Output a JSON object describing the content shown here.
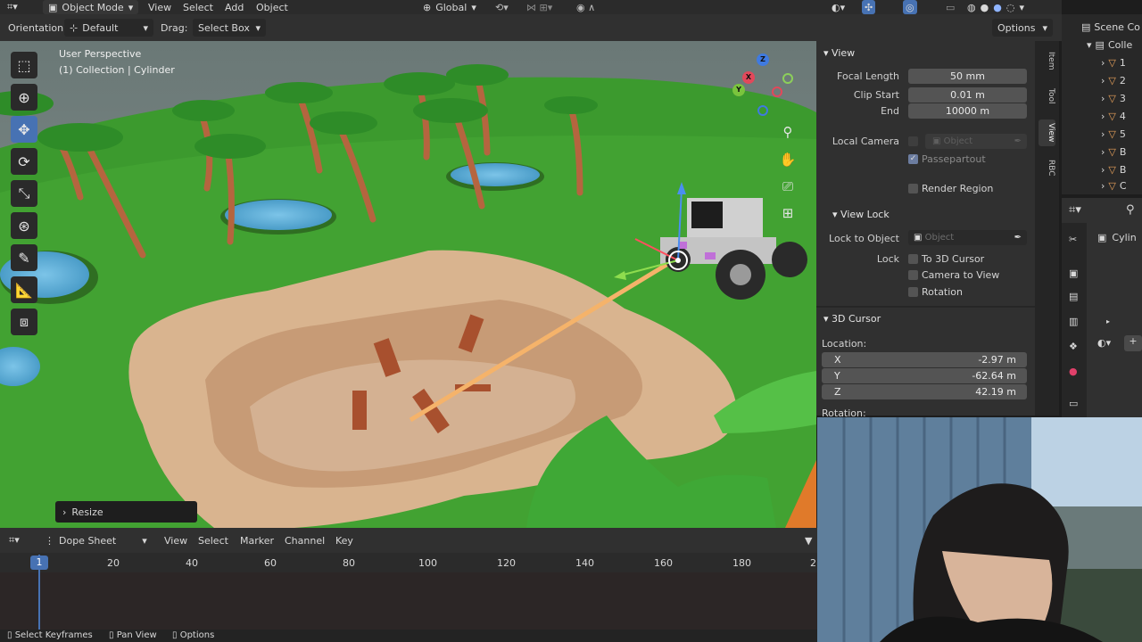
{
  "topbar": {
    "mode": "Object Mode",
    "menus": [
      "View",
      "Select",
      "Add",
      "Object"
    ],
    "transform": "Global"
  },
  "header": {
    "orientation_label": "Orientation:",
    "orientation_value": "Default",
    "drag_label": "Drag:",
    "drag_value": "Select Box",
    "options": "Options"
  },
  "viewport": {
    "perspective": "User Perspective",
    "collection": "(1) Collection | Cylinder",
    "last_op": "Resize",
    "gizmo": {
      "x": "X",
      "y": "Y",
      "z": "Z"
    }
  },
  "npanel": {
    "view": {
      "title": "View",
      "focal_length_label": "Focal Length",
      "focal_length": "50 mm",
      "clip_start_label": "Clip Start",
      "clip_start": "0.01 m",
      "end_label": "End",
      "end": "10000 m",
      "local_camera_label": "Local Camera",
      "local_camera_placeholder": "Object",
      "passepartout": "Passepartout",
      "render_region": "Render Region"
    },
    "view_lock": {
      "title": "View Lock",
      "lock_to_object_label": "Lock to Object",
      "lock_to_object_placeholder": "Object",
      "lock_label": "Lock",
      "to_3d_cursor": "To 3D Cursor",
      "camera_to_view": "Camera to View",
      "rotation": "Rotation"
    },
    "cursor": {
      "title": "3D Cursor",
      "location_label": "Location:",
      "x_label": "X",
      "x": "-2.97 m",
      "y_label": "Y",
      "y": "-62.64 m",
      "z_label": "Z",
      "z": "42.19 m",
      "rotation_label": "Rotation:"
    },
    "tabs": [
      "Item",
      "Tool",
      "View",
      "RBC"
    ]
  },
  "outliner": {
    "scene": "Scene Co",
    "collection": "Colle",
    "items": [
      "1",
      "2",
      "3",
      "4",
      "5",
      "B",
      "B",
      "C"
    ]
  },
  "properties": {
    "object": "Cylin"
  },
  "dopesheet": {
    "editor": "Dope Sheet",
    "menus": [
      "View",
      "Select",
      "Marker",
      "Channel",
      "Key"
    ],
    "current_frame": "1",
    "ticks": [
      "20",
      "40",
      "60",
      "80",
      "100",
      "120",
      "140",
      "160",
      "180",
      "2"
    ]
  },
  "statusbar": {
    "items": [
      "Select Keyframes",
      "Pan View",
      "Options"
    ]
  },
  "colors": {
    "accent": "#4772b3",
    "orange": "#e8a15a",
    "grass": "#3c9a2e"
  }
}
